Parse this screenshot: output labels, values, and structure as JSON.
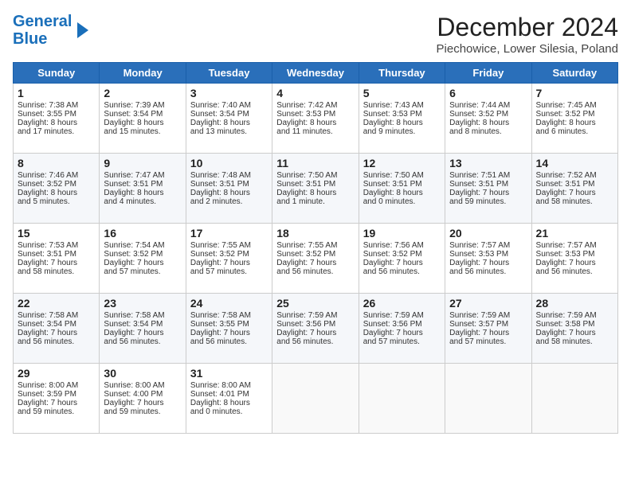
{
  "header": {
    "logo_line1": "General",
    "logo_line2": "Blue",
    "month_title": "December 2024",
    "location": "Piechowice, Lower Silesia, Poland"
  },
  "days_of_week": [
    "Sunday",
    "Monday",
    "Tuesday",
    "Wednesday",
    "Thursday",
    "Friday",
    "Saturday"
  ],
  "weeks": [
    [
      {
        "day": "1",
        "lines": [
          "Sunrise: 7:38 AM",
          "Sunset: 3:55 PM",
          "Daylight: 8 hours",
          "and 17 minutes."
        ]
      },
      {
        "day": "2",
        "lines": [
          "Sunrise: 7:39 AM",
          "Sunset: 3:54 PM",
          "Daylight: 8 hours",
          "and 15 minutes."
        ]
      },
      {
        "day": "3",
        "lines": [
          "Sunrise: 7:40 AM",
          "Sunset: 3:54 PM",
          "Daylight: 8 hours",
          "and 13 minutes."
        ]
      },
      {
        "day": "4",
        "lines": [
          "Sunrise: 7:42 AM",
          "Sunset: 3:53 PM",
          "Daylight: 8 hours",
          "and 11 minutes."
        ]
      },
      {
        "day": "5",
        "lines": [
          "Sunrise: 7:43 AM",
          "Sunset: 3:53 PM",
          "Daylight: 8 hours",
          "and 9 minutes."
        ]
      },
      {
        "day": "6",
        "lines": [
          "Sunrise: 7:44 AM",
          "Sunset: 3:52 PM",
          "Daylight: 8 hours",
          "and 8 minutes."
        ]
      },
      {
        "day": "7",
        "lines": [
          "Sunrise: 7:45 AM",
          "Sunset: 3:52 PM",
          "Daylight: 8 hours",
          "and 6 minutes."
        ]
      }
    ],
    [
      {
        "day": "8",
        "lines": [
          "Sunrise: 7:46 AM",
          "Sunset: 3:52 PM",
          "Daylight: 8 hours",
          "and 5 minutes."
        ]
      },
      {
        "day": "9",
        "lines": [
          "Sunrise: 7:47 AM",
          "Sunset: 3:51 PM",
          "Daylight: 8 hours",
          "and 4 minutes."
        ]
      },
      {
        "day": "10",
        "lines": [
          "Sunrise: 7:48 AM",
          "Sunset: 3:51 PM",
          "Daylight: 8 hours",
          "and 2 minutes."
        ]
      },
      {
        "day": "11",
        "lines": [
          "Sunrise: 7:50 AM",
          "Sunset: 3:51 PM",
          "Daylight: 8 hours",
          "and 1 minute."
        ]
      },
      {
        "day": "12",
        "lines": [
          "Sunrise: 7:50 AM",
          "Sunset: 3:51 PM",
          "Daylight: 8 hours",
          "and 0 minutes."
        ]
      },
      {
        "day": "13",
        "lines": [
          "Sunrise: 7:51 AM",
          "Sunset: 3:51 PM",
          "Daylight: 7 hours",
          "and 59 minutes."
        ]
      },
      {
        "day": "14",
        "lines": [
          "Sunrise: 7:52 AM",
          "Sunset: 3:51 PM",
          "Daylight: 7 hours",
          "and 58 minutes."
        ]
      }
    ],
    [
      {
        "day": "15",
        "lines": [
          "Sunrise: 7:53 AM",
          "Sunset: 3:51 PM",
          "Daylight: 7 hours",
          "and 58 minutes."
        ]
      },
      {
        "day": "16",
        "lines": [
          "Sunrise: 7:54 AM",
          "Sunset: 3:52 PM",
          "Daylight: 7 hours",
          "and 57 minutes."
        ]
      },
      {
        "day": "17",
        "lines": [
          "Sunrise: 7:55 AM",
          "Sunset: 3:52 PM",
          "Daylight: 7 hours",
          "and 57 minutes."
        ]
      },
      {
        "day": "18",
        "lines": [
          "Sunrise: 7:55 AM",
          "Sunset: 3:52 PM",
          "Daylight: 7 hours",
          "and 56 minutes."
        ]
      },
      {
        "day": "19",
        "lines": [
          "Sunrise: 7:56 AM",
          "Sunset: 3:52 PM",
          "Daylight: 7 hours",
          "and 56 minutes."
        ]
      },
      {
        "day": "20",
        "lines": [
          "Sunrise: 7:57 AM",
          "Sunset: 3:53 PM",
          "Daylight: 7 hours",
          "and 56 minutes."
        ]
      },
      {
        "day": "21",
        "lines": [
          "Sunrise: 7:57 AM",
          "Sunset: 3:53 PM",
          "Daylight: 7 hours",
          "and 56 minutes."
        ]
      }
    ],
    [
      {
        "day": "22",
        "lines": [
          "Sunrise: 7:58 AM",
          "Sunset: 3:54 PM",
          "Daylight: 7 hours",
          "and 56 minutes."
        ]
      },
      {
        "day": "23",
        "lines": [
          "Sunrise: 7:58 AM",
          "Sunset: 3:54 PM",
          "Daylight: 7 hours",
          "and 56 minutes."
        ]
      },
      {
        "day": "24",
        "lines": [
          "Sunrise: 7:58 AM",
          "Sunset: 3:55 PM",
          "Daylight: 7 hours",
          "and 56 minutes."
        ]
      },
      {
        "day": "25",
        "lines": [
          "Sunrise: 7:59 AM",
          "Sunset: 3:56 PM",
          "Daylight: 7 hours",
          "and 56 minutes."
        ]
      },
      {
        "day": "26",
        "lines": [
          "Sunrise: 7:59 AM",
          "Sunset: 3:56 PM",
          "Daylight: 7 hours",
          "and 57 minutes."
        ]
      },
      {
        "day": "27",
        "lines": [
          "Sunrise: 7:59 AM",
          "Sunset: 3:57 PM",
          "Daylight: 7 hours",
          "and 57 minutes."
        ]
      },
      {
        "day": "28",
        "lines": [
          "Sunrise: 7:59 AM",
          "Sunset: 3:58 PM",
          "Daylight: 7 hours",
          "and 58 minutes."
        ]
      }
    ],
    [
      {
        "day": "29",
        "lines": [
          "Sunrise: 8:00 AM",
          "Sunset: 3:59 PM",
          "Daylight: 7 hours",
          "and 59 minutes."
        ]
      },
      {
        "day": "30",
        "lines": [
          "Sunrise: 8:00 AM",
          "Sunset: 4:00 PM",
          "Daylight: 7 hours",
          "and 59 minutes."
        ]
      },
      {
        "day": "31",
        "lines": [
          "Sunrise: 8:00 AM",
          "Sunset: 4:01 PM",
          "Daylight: 8 hours",
          "and 0 minutes."
        ]
      },
      null,
      null,
      null,
      null
    ]
  ]
}
